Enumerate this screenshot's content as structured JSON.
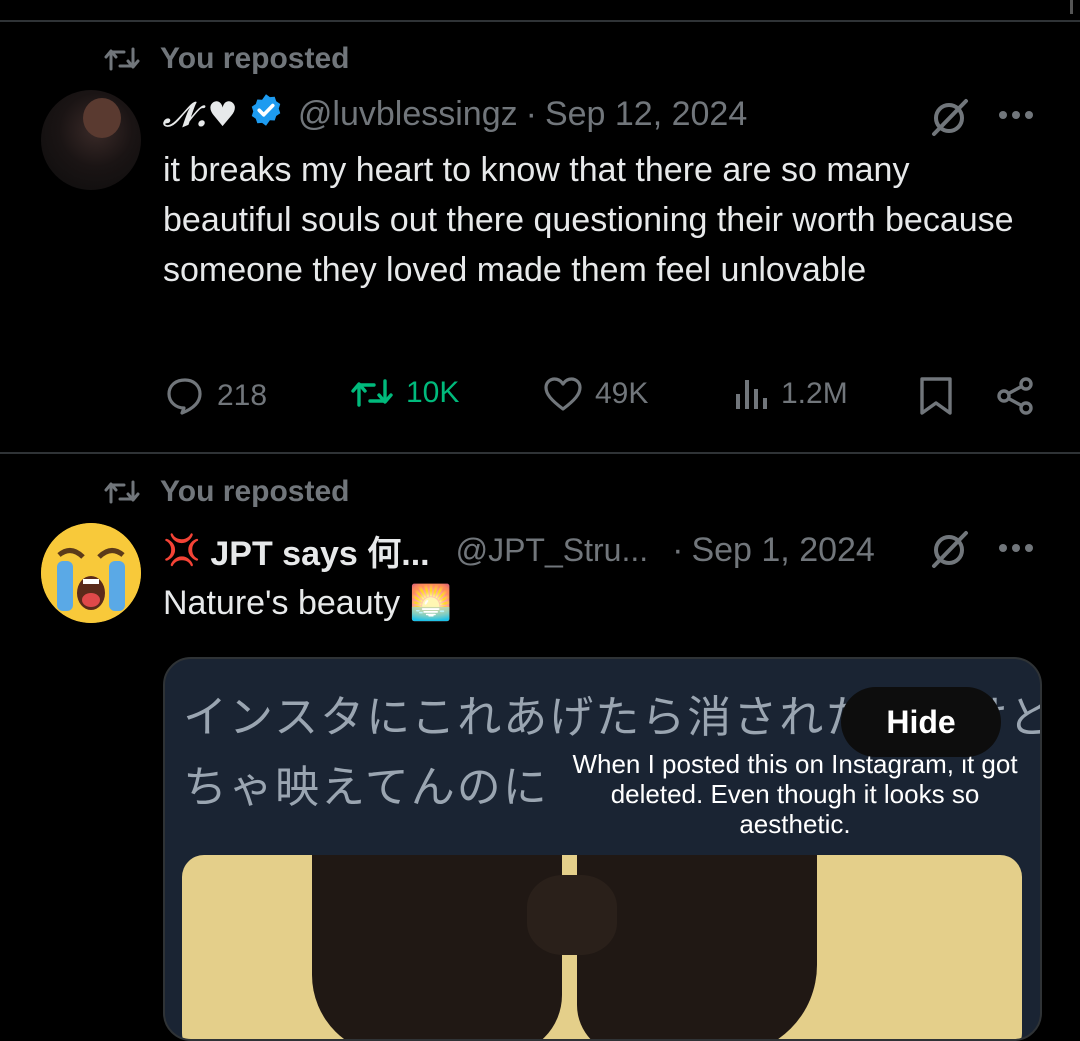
{
  "posts": [
    {
      "repost_label": "You reposted",
      "name": "𝒩.♥",
      "handle": "@luvblessingz",
      "separator": "·",
      "date": "Sep 12, 2024",
      "text": "it breaks my heart to know that there are so many beautiful souls out there questioning their worth because someone they loved made them feel unlovable",
      "stats": {
        "replies": "218",
        "reposts": "10K",
        "likes": "49K",
        "views": "1.2M"
      },
      "verified": true,
      "reposted": true
    },
    {
      "repost_label": "You reposted",
      "name_emoji": "💢",
      "name": "JPT says 何...",
      "handle": "@JPT_Stru...",
      "separator": "·",
      "date": "Sep 1, 2024",
      "text": "Nature's beauty 🌅",
      "media": {
        "jp_line1": "インスタにこれあげたら消されたんだけど",
        "jp_line2": "ちゃ映えてんのに",
        "translation": "When I posted this on Instagram, it got deleted. Even though it looks so aesthetic.",
        "hide_label": "Hide"
      }
    }
  ],
  "colors": {
    "accent_green": "#00ba7c",
    "verified_blue": "#1d9bf0",
    "muted": "#71767b"
  },
  "icons": [
    "repost-icon",
    "verified-badge-icon",
    "grok-icon",
    "more-icon",
    "reply-icon",
    "like-icon",
    "views-icon",
    "bookmark-icon",
    "share-icon"
  ]
}
